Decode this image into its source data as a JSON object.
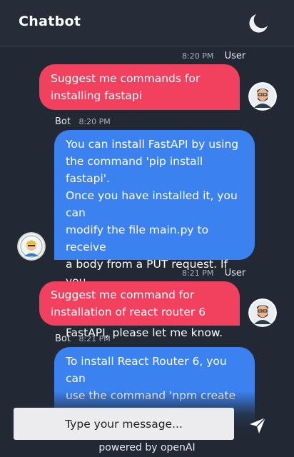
{
  "header": {
    "title": "Chatbot",
    "theme_toggle_icon": "moon-icon"
  },
  "messages": [
    {
      "sender": "User",
      "time": "8:20 PM",
      "text": "Suggest me commands for\ninstalling fastapi"
    },
    {
      "sender": "Bot",
      "time": "8:20 PM",
      "text": "You can install FastAPI by using\nthe command 'pip install fastapi'.\nOnce you have installed it, you can\nmodify the file main.py to receive\na body from a PUT request. If you\nhave any further questions about\nFastAPI, please let me know."
    },
    {
      "sender": "User",
      "time": "8:21 PM",
      "text": "Suggest me command for\ninstallation of react router 6"
    },
    {
      "sender": "Bot",
      "time": "8:21 PM",
      "text": "To install React Router 6, you can\nuse the command 'npm create\nvite@latest name-of-your-project -"
    }
  ],
  "composer": {
    "placeholder": "Type your message...",
    "send_icon": "send-icon"
  },
  "footer": {
    "powered_by": "powered by openAI"
  },
  "colors": {
    "user_bubble": "#f2405f",
    "bot_bubble": "#3b82f0",
    "background": "#222834"
  }
}
